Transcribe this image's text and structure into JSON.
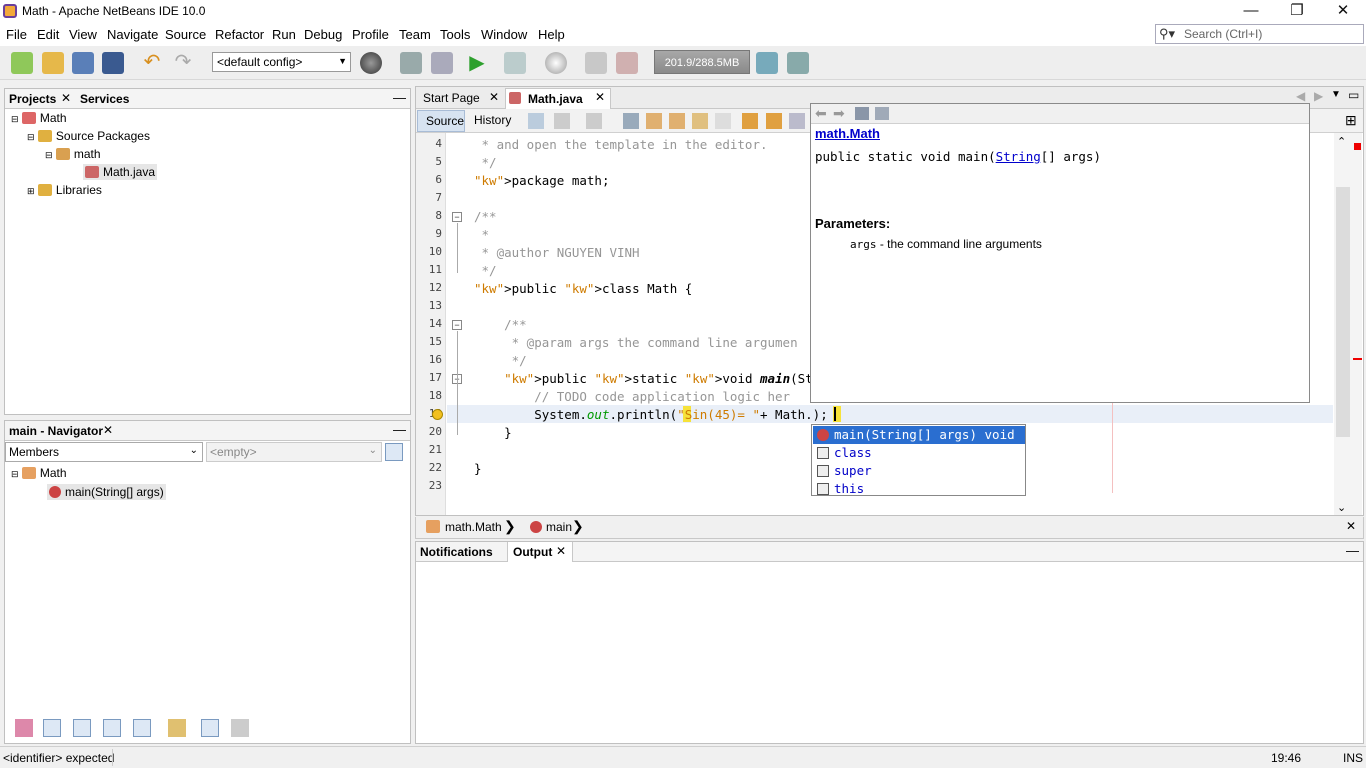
{
  "window": {
    "title": "Math - Apache NetBeans IDE 10.0"
  },
  "menu": [
    "File",
    "Edit",
    "View",
    "Navigate",
    "Source",
    "Refactor",
    "Run",
    "Debug",
    "Profile",
    "Team",
    "Tools",
    "Window",
    "Help"
  ],
  "search": {
    "placeholder": "Search (Ctrl+I)"
  },
  "toolbar": {
    "config": "<default config>",
    "memory": "201.9/288.5MB"
  },
  "projects": {
    "tabs": [
      "Projects",
      "Services"
    ],
    "tree": [
      "Math",
      "Source Packages",
      "math",
      "Math.java",
      "Libraries"
    ]
  },
  "navigator": {
    "title": "main - Navigator",
    "filter": "Members",
    "filter2": "<empty>",
    "tree": [
      "Math",
      "main(String[] args)"
    ]
  },
  "editor": {
    "tabs": [
      "Start Page",
      "Math.java"
    ],
    "modes": [
      "Source",
      "History"
    ],
    "lines": [
      4,
      5,
      6,
      7,
      8,
      9,
      10,
      11,
      12,
      13,
      14,
      15,
      16,
      17,
      18,
      19,
      20,
      21,
      22,
      23
    ],
    "code": [
      " * and open the template in the editor.",
      " */",
      "package math;",
      "",
      "/**",
      " *",
      " * @author NGUYEN VINH",
      " */",
      "public class Math {",
      "",
      "    /**",
      "     * @param args the command line argumen",
      "     */",
      "    public static void main(String[] args)",
      "        // TODO code application logic her",
      "        System.out.println(\"Sin(45)= \"+ Math.);",
      "    }",
      "",
      "}",
      ""
    ]
  },
  "javadoc": {
    "link": "math.Math",
    "signature_pre": "public static void main(",
    "signature_link": "String",
    "signature_post": "[] args)",
    "params_label": "Parameters:",
    "param_name": "args",
    "param_desc": " - the command line arguments"
  },
  "completion": [
    "main(String[] args) void",
    "class",
    "super",
    "this"
  ],
  "breadcrumb": [
    "math.Math",
    "main"
  ],
  "output": {
    "tabs": [
      "Notifications",
      "Output"
    ]
  },
  "status": {
    "message": "<identifier> expected",
    "position": "19:46",
    "mode": "INS"
  }
}
